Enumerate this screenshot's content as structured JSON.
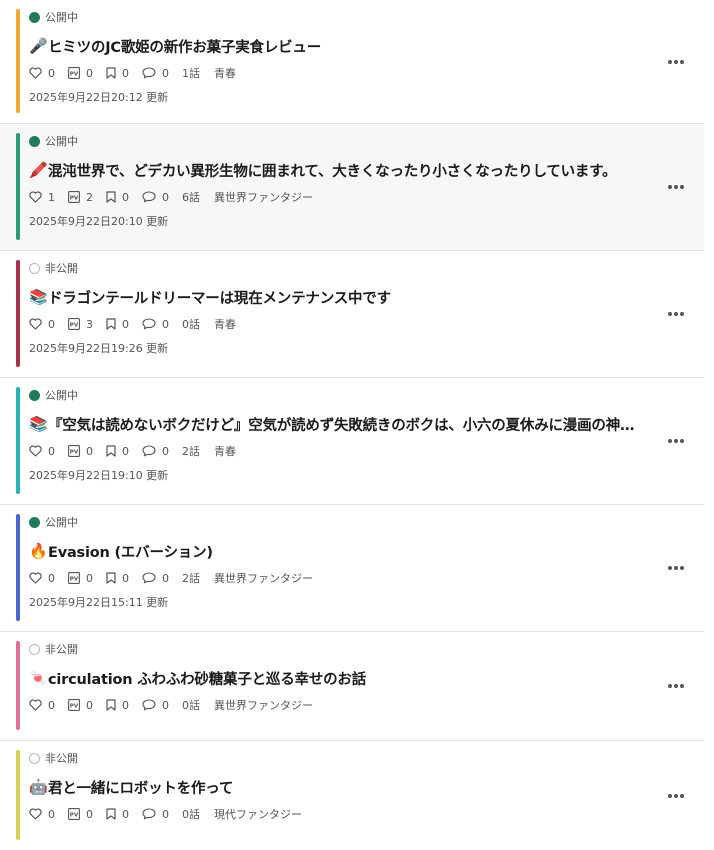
{
  "works": [
    {
      "status": "公開中",
      "status_type": "public",
      "stripe_color": "#f0a830",
      "emoji": "🎤",
      "title": "ヒミツのJC歌姫の新作お菓子実食レビュー",
      "likes": "0",
      "pv": "0",
      "bookmarks": "0",
      "comments": "0",
      "episodes": "1話",
      "genre": "青春",
      "updated": "2025年9月22日20:12 更新"
    },
    {
      "status": "公開中",
      "status_type": "public",
      "stripe_color": "#2a9a78",
      "emoji": "🖍️",
      "title": "混沌世界で、どデカい異形生物に囲まれて、大きくなったり小さくなったりしています。",
      "likes": "1",
      "pv": "2",
      "bookmarks": "0",
      "comments": "0",
      "episodes": "6話",
      "genre": "異世界ファンタジー",
      "updated": "2025年9月22日20:10 更新"
    },
    {
      "status": "非公開",
      "status_type": "private",
      "stripe_color": "#a8304a",
      "emoji": "📚",
      "title": "ドラゴンテールドリーマーは現在メンテナンス中です",
      "likes": "0",
      "pv": "3",
      "bookmarks": "0",
      "comments": "0",
      "episodes": "0話",
      "genre": "青春",
      "updated": "2025年9月22日19:26 更新"
    },
    {
      "status": "公開中",
      "status_type": "public",
      "stripe_color": "#2ab5b5",
      "emoji": "📚",
      "title": "『空気は読めないボクだけど』空気が読めず失敗続きのボクは、小六の夏休みに漫画の神様かもしれない存在と出会った",
      "likes": "0",
      "pv": "0",
      "bookmarks": "0",
      "comments": "0",
      "episodes": "2話",
      "genre": "青春",
      "updated": "2025年9月22日19:10 更新"
    },
    {
      "status": "公開中",
      "status_type": "public",
      "stripe_color": "#4a68c8",
      "emoji": "🔥",
      "title": "Evasion (エバーション)",
      "likes": "0",
      "pv": "0",
      "bookmarks": "0",
      "comments": "0",
      "episodes": "2話",
      "genre": "異世界ファンタジー",
      "updated": "2025年9月22日15:11 更新"
    },
    {
      "status": "非公開",
      "status_type": "private",
      "stripe_color": "#e07098",
      "emoji": "🍬",
      "title": "circulation ふわふわ砂糖菓子と巡る幸せのお話",
      "likes": "0",
      "pv": "0",
      "bookmarks": "0",
      "comments": "0",
      "episodes": "0話",
      "genre": "異世界ファンタジー",
      "updated": ""
    },
    {
      "status": "非公開",
      "status_type": "private",
      "stripe_color": "#d8d050",
      "emoji": "🤖",
      "title": "君と一緒にロボットを作って",
      "likes": "0",
      "pv": "0",
      "bookmarks": "0",
      "comments": "0",
      "episodes": "0話",
      "genre": "現代ファンタジー",
      "updated": ""
    }
  ],
  "icons": {
    "like": "heart-icon",
    "pv": "pv-icon",
    "bookmark": "bookmark-icon",
    "comment": "comment-icon",
    "more": "more-options-icon"
  }
}
